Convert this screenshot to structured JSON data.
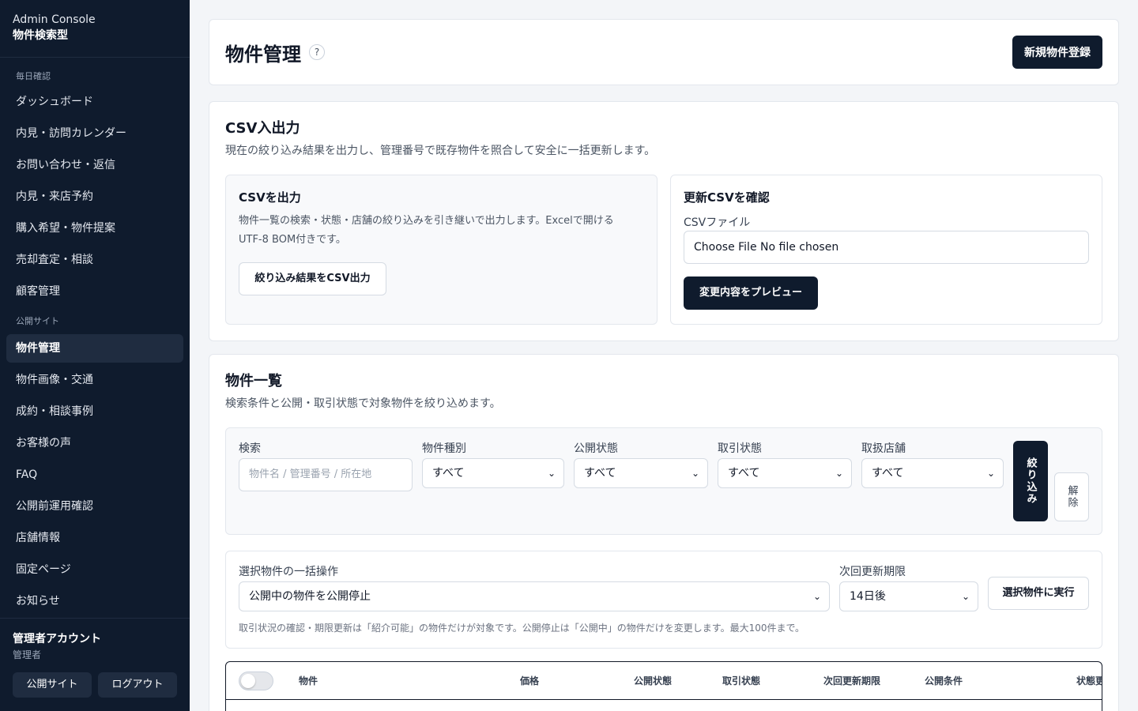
{
  "brand": {
    "title": "Admin Console",
    "subtitle": "物件検索型"
  },
  "nav": {
    "section_daily": "毎日確認",
    "daily_items": [
      "ダッシュボード",
      "内見・訪問カレンダー",
      "お問い合わせ・返信",
      "内見・来店予約",
      "購入希望・物件提案",
      "売却査定・相談",
      "顧客管理"
    ],
    "section_public": "公開サイト",
    "public_items": [
      "物件管理",
      "物件画像・交通",
      "成約・相談事例",
      "お客様の声",
      "FAQ",
      "公開前運用確認",
      "店舗情報",
      "固定ページ",
      "お知らせ"
    ]
  },
  "account": {
    "name": "管理者アカウント",
    "role": "管理者",
    "public_site_label": "公開サイト",
    "logout_label": "ログアウト"
  },
  "header": {
    "title": "物件管理",
    "help": "?",
    "new_button": "新規物件登録"
  },
  "csv": {
    "title": "CSV入出力",
    "description": "現在の絞り込み結果を出力し、管理番号で既存物件を照合して安全に一括更新します。",
    "export": {
      "title": "CSVを出力",
      "description_line1": "物件一覧の検索・状態・店舗の絞り込みを引き継いで出力します。Excelで開ける",
      "description_line2": "UTF-8 BOM付きです。",
      "button": "絞り込み結果をCSV出力"
    },
    "import": {
      "title": "更新CSVを確認",
      "file_label": "CSVファイル",
      "file_value": "Choose File No file chosen",
      "preview_button": "変更内容をプレビュー"
    }
  },
  "list": {
    "title": "物件一覧",
    "description": "検索条件と公開・取引状態で対象物件を絞り込めます。",
    "filters": {
      "search_label": "検索",
      "search_placeholder": "物件名 / 管理番号 / 所在地",
      "type_label": "物件種別",
      "type_value": "すべて",
      "publish_label": "公開状態",
      "publish_value": "すべて",
      "deal_label": "取引状態",
      "deal_value": "すべて",
      "store_label": "取扱店舗",
      "store_value": "すべて",
      "apply_button": "絞り込み",
      "clear_button": "解除"
    },
    "bulk": {
      "action_label": "選択物件の一括操作",
      "action_value": "公開中の物件を公開停止",
      "deadline_label": "次回更新期限",
      "deadline_value": "14日後",
      "run_button": "選択物件に実行",
      "note": "取引状況の確認・期限更新は「紹介可能」の物件だけが対象です。公開停止は「公開中」の物件だけを変更します。最大100件まで。"
    },
    "table": {
      "columns": [
        "物件",
        "価格",
        "公開状態",
        "取引状態",
        "次回更新期限",
        "公開条件",
        "状態更"
      ]
    }
  },
  "colors": {
    "sidebar_bg": "#0f1b2d",
    "primary": "#0f1b2d",
    "page_bg": "#f3f5f8"
  }
}
